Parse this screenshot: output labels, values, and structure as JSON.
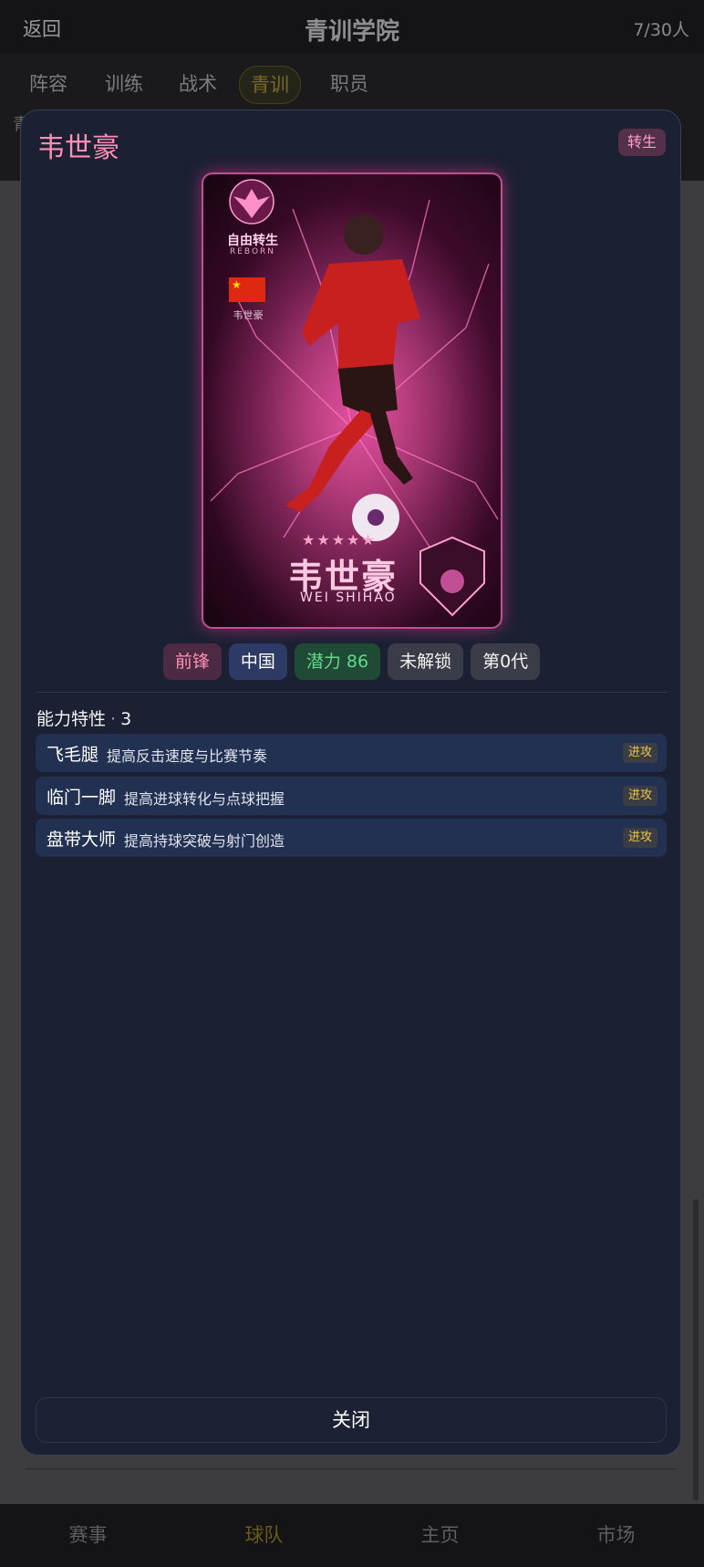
{
  "header": {
    "back_label": "返回",
    "title": "青训学院",
    "count": "7/30人"
  },
  "tabs": [
    {
      "label": "阵容",
      "active": false
    },
    {
      "label": "训练",
      "active": false
    },
    {
      "label": "战术",
      "active": false
    },
    {
      "label": "青训",
      "active": true
    },
    {
      "label": "职员",
      "active": false
    }
  ],
  "bg_text_fragment": "青",
  "bottom_nav": [
    {
      "label": "赛事",
      "active": false
    },
    {
      "label": "球队",
      "active": true
    },
    {
      "label": "主页",
      "active": false
    },
    {
      "label": "市场",
      "active": false
    }
  ],
  "modal": {
    "player_name": "韦世豪",
    "status_badge": "转生",
    "card": {
      "tag_cn": "自由转生",
      "tag_en": "REBORN",
      "flag_label": "韦世豪",
      "stars": "★★★★★",
      "big_name": "韦世豪",
      "pinyin": "WEI SHIHAO"
    },
    "chips": {
      "position": "前锋",
      "nationality": "中国",
      "potential": "潜力 86",
      "lock_state": "未解锁",
      "generation": "第0代"
    },
    "traits_section": {
      "title": "能力特性",
      "count": "3"
    },
    "traits": [
      {
        "name": "飞毛腿",
        "desc": "提高反击速度与比赛节奏",
        "tag": "进攻"
      },
      {
        "name": "临门一脚",
        "desc": "提高进球转化与点球把握",
        "tag": "进攻"
      },
      {
        "name": "盘带大师",
        "desc": "提高持球突破与射门创造",
        "tag": "进攻"
      }
    ],
    "close_label": "关闭"
  },
  "colors": {
    "accent_pink": "#ff8fb5",
    "modal_bg": "#1b2032",
    "trait_bg": "#223151",
    "tag_gold": "#f0c64a",
    "potential_green": "#62d98a"
  }
}
